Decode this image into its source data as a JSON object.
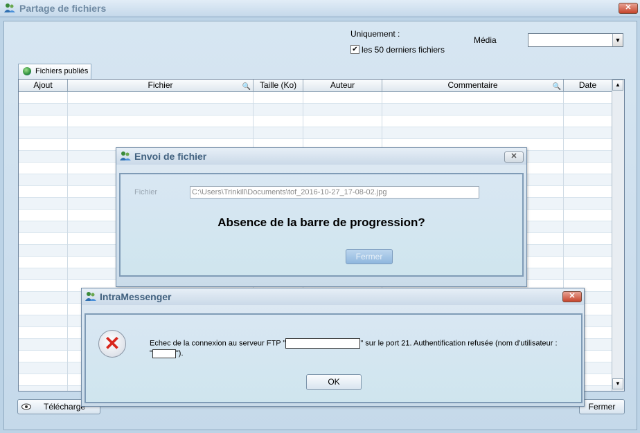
{
  "main": {
    "title": "Partage de fichiers",
    "uniquement_label": "Uniquement :",
    "checkbox_label": "les 50 derniers fichiers",
    "checkbox_checked": true,
    "checkbox_mark": "✔",
    "media_label": "Média",
    "media_value": "",
    "tab_label": "Fichiers publiés",
    "columns": [
      "Ajout",
      "Fichier",
      "Taille (Ko)",
      "Auteur",
      "Commentaire",
      "Date"
    ],
    "download_label": "Télécharge",
    "close_label": "Fermer",
    "close_glyph": "✕",
    "search_glyph": "🔍",
    "scroll_up": "▲",
    "scroll_down": "▼",
    "combo_arrow": "▼"
  },
  "envoi_dialog": {
    "title": "Envoi de fichier",
    "fichier_label": "Fichier",
    "fichier_value": "C:\\Users\\Trinkill\\Documents\\tof_2016-10-27_17-08-02.jpg",
    "question": "Absence de la barre de progression?",
    "close_button": "Fermer",
    "close_glyph": "✕"
  },
  "error_dialog": {
    "title": "IntraMessenger",
    "message_part1": "Echec de la connexion au serveur FTP \"",
    "message_part2": "\" sur le port 21. Authentification refusée (nom d'utilisateur :",
    "message_part3": "\"",
    "message_part4": "\").",
    "ok_button": "OK",
    "error_glyph": "✕",
    "close_glyph": "✕"
  },
  "icons": {
    "app": "messenger-users-icon",
    "globe": "globe-icon",
    "eye": "eye-icon",
    "error": "error-icon"
  },
  "colors": {
    "error_red": "#d8261c",
    "title_text": "#41617f"
  }
}
